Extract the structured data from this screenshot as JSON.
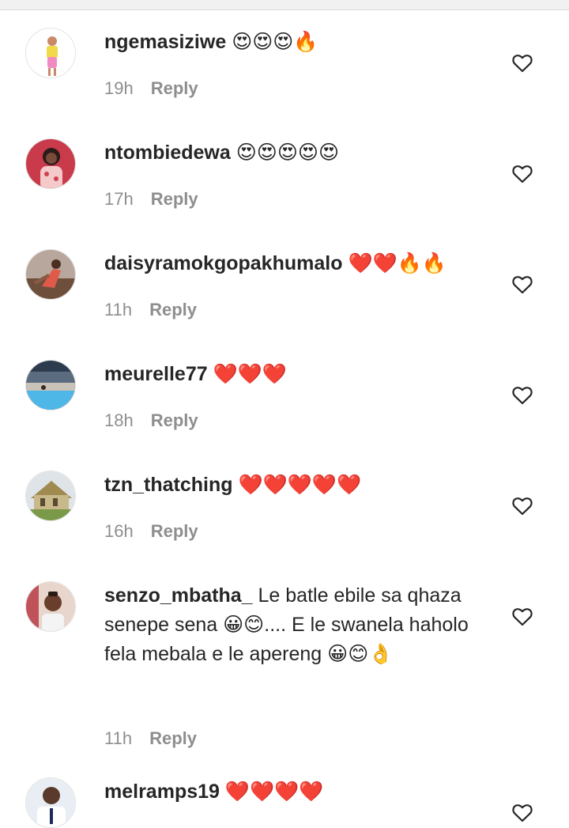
{
  "comments": [
    {
      "username": "ngemasiziwe",
      "text": "😍😍😍🔥",
      "time": "19h",
      "reply": "Reply",
      "avatar_color": "#f5d36b"
    },
    {
      "username": "ntombiedewa",
      "text": "😍😍😍😍😍",
      "time": "17h",
      "reply": "Reply",
      "avatar_color": "#c93a4a"
    },
    {
      "username": "daisyramokgopakhumalo",
      "text": "❤️❤️🔥🔥",
      "time": "11h",
      "reply": "Reply",
      "avatar_color": "#8a5a44"
    },
    {
      "username": "meurelle77",
      "text": "❤️❤️❤️",
      "time": "18h",
      "reply": "Reply",
      "avatar_color": "#5aa6d6"
    },
    {
      "username": "tzn_thatching",
      "text": "❤️❤️❤️❤️❤️",
      "time": "16h",
      "reply": "Reply",
      "avatar_color": "#9b8a55"
    },
    {
      "username": "senzo_mbatha_",
      "text": "Le batle ebile sa qhaza senepe sena 😀😊.... E le swanela haholo fela mebala e le apereng 😀😊👌",
      "time": "11h",
      "reply": "Reply",
      "avatar_color": "#d9b8a6"
    },
    {
      "username": "melramps19",
      "text": "❤️❤️❤️❤️",
      "time": "",
      "reply": "",
      "avatar_color": "#4a7fb8"
    }
  ],
  "colors": {
    "text": "#262626",
    "muted": "#8e8e8e",
    "background": "#ffffff"
  },
  "icons": {
    "like": "heart-outline-icon"
  }
}
